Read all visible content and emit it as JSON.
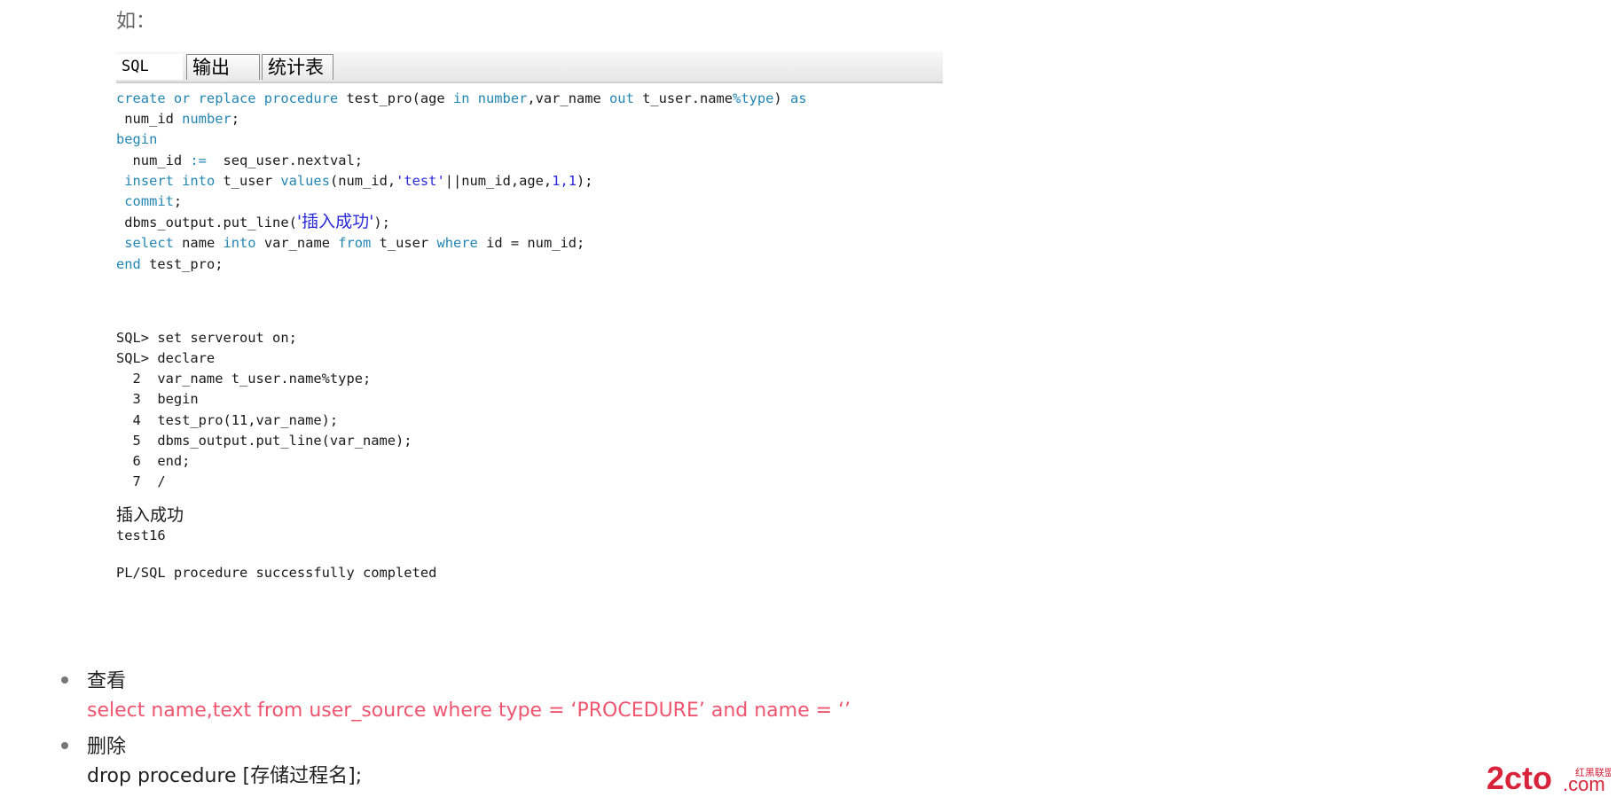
{
  "intro": "如：",
  "tabs": {
    "sql": "SQL",
    "output": "输出",
    "stats": "统计表"
  },
  "editor": {
    "l1_kw1": "create or replace procedure",
    "l1_a": " test_pro(age ",
    "l1_kw2": "in",
    "l1_sp": " ",
    "l1_kw3": "number",
    "l1_b": ",var_name ",
    "l1_kw4": "out",
    "l1_c": " t_user.name",
    "l1_kw5": "%type",
    "l1_d": ") ",
    "l1_kw6": "as",
    "l2_a": " num_id ",
    "l2_kw": "number",
    "l2_b": ";",
    "l3_kw": "begin",
    "l4_a": "  num_id ",
    "l4_kw": ":=",
    "l4_b": "  seq_user.nextval;",
    "l5_sp": " ",
    "l5_kw1": "insert into",
    "l5_a": " t_user ",
    "l5_kw2": "values",
    "l5_b": "(num_id,",
    "l5_str": "'test'",
    "l5_c": "||num_id,age,",
    "l5_n1": "1",
    "l5_comma": ",",
    "l5_n2": "1",
    "l5_d": ");",
    "l6_sp": " ",
    "l6_kw": "commit",
    "l6_b": ";",
    "l7_a": " dbms_output.put_line(",
    "l7_str": "'插入成功'",
    "l7_b": ");",
    "l8_sp": " ",
    "l8_kw1": "select",
    "l8_a": " name ",
    "l8_kw2": "into",
    "l8_b": " var_name ",
    "l8_kw3": "from",
    "l8_c": " t_user ",
    "l8_kw4": "where",
    "l8_d": " id = num_id;",
    "l9_kw": "end",
    "l9_a": " test_pro;"
  },
  "console": {
    "lines": [
      "SQL> set serverout on;",
      "SQL> declare",
      "  2  var_name t_user.name%type;",
      "  3  begin",
      "  4  test_pro(11,var_name);",
      "  5  dbms_output.put_line(var_name);",
      "  6  end;",
      "  7  /"
    ],
    "out_cjk": "插入成功",
    "out_value": "test16",
    "completed": "PL/SQL procedure successfully completed"
  },
  "bullets": [
    {
      "title": "查看",
      "body": "select name,text from user_source where type = ‘PROCEDURE’ and name = ‘’"
    },
    {
      "title": "删除",
      "body": "drop procedure [存储过程名];"
    }
  ],
  "watermark": {
    "main": "2cto",
    "sub": ".com",
    "small": "红黑联盟"
  },
  "colors": {
    "keyword": "#2486b3",
    "literal": "#2a2ad8",
    "pink": "#f05570"
  }
}
